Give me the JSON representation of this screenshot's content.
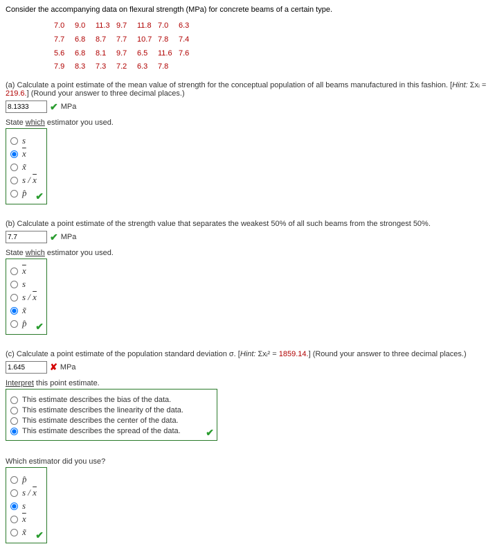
{
  "intro": "Consider the accompanying data on flexural strength (MPa) for concrete beams of a certain type.",
  "data_rows": [
    [
      "7.0",
      "9.0",
      "11.3",
      "9.7",
      "11.8",
      "7.0",
      "6.3"
    ],
    [
      "7.7",
      "6.8",
      "8.7",
      "7.7",
      "10.7",
      "7.8",
      "7.4"
    ],
    [
      "5.6",
      "6.8",
      "8.1",
      "9.7",
      "6.5",
      "11.6",
      "7.6"
    ],
    [
      "7.9",
      "8.3",
      "7.3",
      "7.2",
      "6.3",
      "7.8",
      ""
    ]
  ],
  "partA": {
    "text_before": "(a) Calculate a point estimate of the mean value of strength for the conceptual population of all beams manufactured in this fashion. [",
    "hint_label": "Hint:",
    "hint_sigma": " Σxᵢ = ",
    "hint_value": "219.6.",
    "text_after": "] (Round your answer to three decimal places.)",
    "answer": "8.1333",
    "unit": "MPa",
    "state_label": "State which estimator you used.",
    "options": [
      "s",
      "x̄",
      "x̃",
      "s / x̄",
      "p̂"
    ],
    "selected": 1
  },
  "partB": {
    "text": "(b) Calculate a point estimate of the strength value that separates the weakest 50% of all such beams from the strongest 50%.",
    "answer": "7.7",
    "unit": "MPa",
    "state_label": "State which estimator you used.",
    "options": [
      "x̄",
      "s",
      "s / x̄",
      "x̃",
      "p̂"
    ],
    "selected": 3
  },
  "partC": {
    "text_before": "(c) Calculate a point estimate of the population standard deviation σ. [",
    "hint_label": "Hint:",
    "hint_sigma": " Σxᵢ² = ",
    "hint_value": "1859.14.",
    "text_after": "] (Round your answer to three decimal places.)",
    "answer": "1.645",
    "unit": "MPa",
    "interp_label": "Interpret this point estimate.",
    "interp_options": [
      "This estimate describes the bias of the data.",
      "This estimate describes the linearity of the data.",
      "This estimate describes the center of the data.",
      "This estimate describes the spread of the data."
    ],
    "interp_selected": 3,
    "which_label": "Which estimator did you use?",
    "which_options": [
      "p̂",
      "s / x̄",
      "s",
      "x̄",
      "x̃"
    ],
    "which_selected": 2
  }
}
